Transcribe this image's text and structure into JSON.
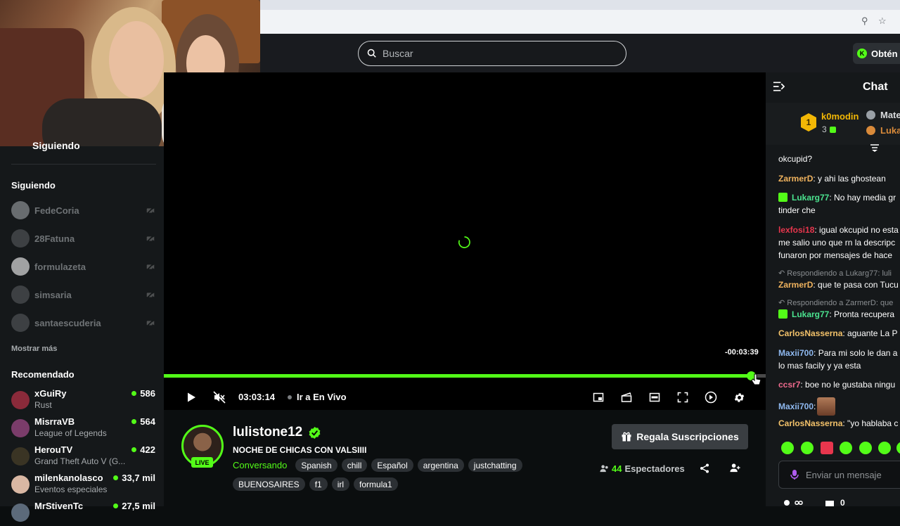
{
  "search": {
    "placeholder": "Buscar"
  },
  "header": {
    "get_label": "Obtén"
  },
  "sidebar": {
    "following_header": "Siguiendo",
    "following_title": "Siguiendo",
    "following": [
      "FedeCoria",
      "28Fatuna",
      "formulazeta",
      "simsaria",
      "santaescuderia"
    ],
    "show_more": "Mostrar más",
    "recommended_title": "Recomendado",
    "recommended": [
      {
        "name": "xGuiRy",
        "category": "Rust",
        "viewers": "586"
      },
      {
        "name": "MisrraVB",
        "category": "League of Legends",
        "viewers": "564"
      },
      {
        "name": "HerouTV",
        "category": "Grand Theft Auto V (G...",
        "viewers": "422"
      },
      {
        "name": "milenkanolasco",
        "category": "Eventos especiales",
        "viewers": "33,7 mil"
      },
      {
        "name": "MrStivenTc",
        "category": "",
        "viewers": "27,5 mil"
      }
    ]
  },
  "player": {
    "remaining": "-00:03:39",
    "progress": 0.975,
    "time": "03:03:14",
    "live_link": "Ir a En Vivo"
  },
  "stream": {
    "channel": "lulistone12",
    "live_badge": "LIVE",
    "title": "NOCHE DE CHICAS CON VALSIIII",
    "category": "Conversando",
    "tags_row1": [
      "Spanish",
      "chill",
      "Español",
      "argentina",
      "justchatting"
    ],
    "tags_row2": [
      "BUENOSAIRES",
      "f1",
      "irl",
      "formula1"
    ],
    "gift_label": "Regala Suscripciones",
    "viewer_count": "44",
    "viewer_label": "Espectadores"
  },
  "chat": {
    "title": "Chat",
    "leaderboard": {
      "rank1_name": "k0modin",
      "rank1_count": "3",
      "rank2_name": "Mate",
      "rank3_name": "Luka"
    },
    "messages": [
      {
        "user": "",
        "text": "okcupid?"
      },
      {
        "user": "ZarmerD",
        "text": ": y ahi las ghostean"
      },
      {
        "user": "Lukarg77",
        "text": ": No hay media gr"
      },
      {
        "user": "",
        "text": "tinder che"
      },
      {
        "user": "lexfosi18",
        "text": ": igual okcupid no esta"
      },
      {
        "user": "",
        "text": "me salio uno que rn la descripc"
      },
      {
        "user": "",
        "text": "funaron por mensajes de hace"
      },
      {
        "user": "ZarmerD",
        "text": ": que te pasa con Tucu"
      },
      {
        "user": "Lukarg77",
        "text": ": Pronta recupera"
      },
      {
        "user": "CarlosNasserna",
        "text": ": aguante La P"
      },
      {
        "user": "Maxii700",
        "text": ": Para mi solo le dan a"
      },
      {
        "user": "",
        "text": "lo mas facily y ya esta"
      },
      {
        "user": "ccsr7",
        "text": ": boe no le gustaba ningu"
      },
      {
        "user": "Maxii700",
        "text": ":"
      },
      {
        "user": "CarlosNasserna",
        "text": ": \"yo hablaba c"
      }
    ],
    "replies": [
      "Respondiendo a Lukarg77: luli",
      "Respondiendo a ZarmerD: que"
    ],
    "input_placeholder": "Enviar un mensaje",
    "bottom_count": "0"
  },
  "colors": {
    "accent": "#53fc18",
    "zarmer": "#f0b35e",
    "lukarg": "#4be38f",
    "lexfosi": "#e7364d",
    "carlos": "#f3c26a",
    "maxii": "#8fb9f0",
    "ccsr": "#f06b8e"
  }
}
